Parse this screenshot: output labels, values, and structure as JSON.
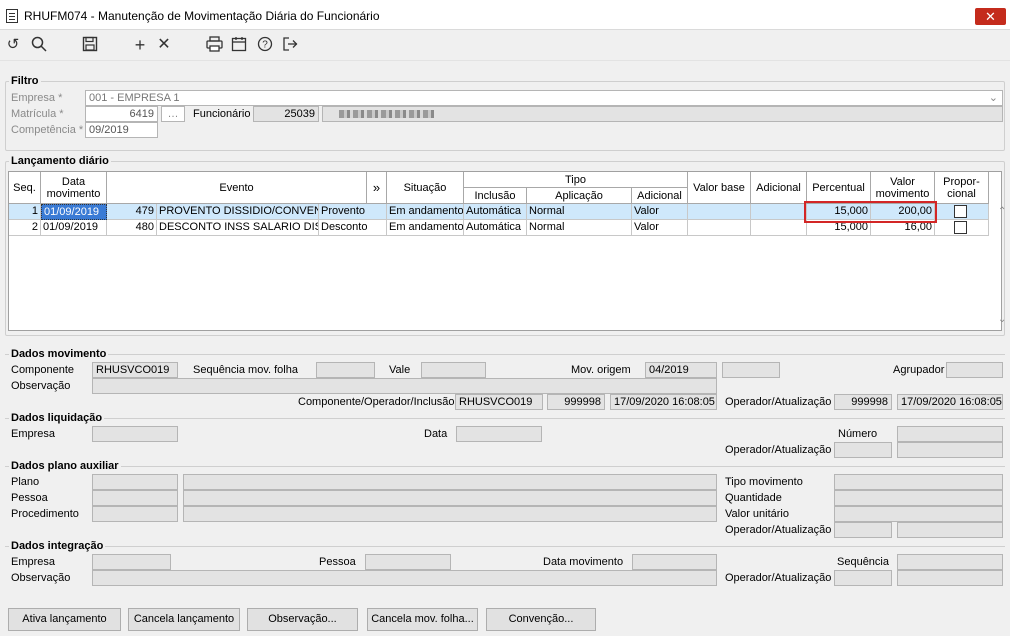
{
  "window": {
    "title": "RHUFM074 - Manutenção de Movimentação Diária do Funcionário",
    "close_label": "✕"
  },
  "toolbar": {
    "icons": [
      "undo-icon",
      "search-icon",
      "save-icon",
      "add-icon",
      "cancel-icon",
      "print-icon",
      "calendar-icon",
      "help-icon",
      "exit-icon"
    ]
  },
  "filtro": {
    "legend": "Filtro",
    "empresa_label": "Empresa *",
    "empresa_value": "001 - EMPRESA 1",
    "matricula_label": "Matrícula *",
    "matricula_value": "6419",
    "funcionario_label": "Funcionário",
    "funcionario_value": "25039",
    "competencia_label": "Competência *",
    "competencia_value": "09/2019"
  },
  "lancamento": {
    "legend": "Lançamento diário",
    "headers": {
      "seq": "Seq.",
      "data": "Data movimento",
      "evento": "Evento",
      "more": "»",
      "situacao": "Situação",
      "tipo": "Tipo",
      "inclusao": "Inclusão",
      "aplicacao": "Aplicação",
      "adicional": "Adicional",
      "valor_base": "Valor base",
      "adicional2": "Adicional",
      "percentual": "Percentual",
      "valor_movimento": "Valor movimento",
      "proporcional": "Propor-cional"
    },
    "rows": [
      {
        "seq": "1",
        "data": "01/09/2019",
        "codigo": "479",
        "evento": "PROVENTO DISSIDIO/CONVENCÃ",
        "tipo_evento": "Provento",
        "situacao": "Em andamento",
        "inclusao": "Automática",
        "aplicacao": "Normal",
        "adicional": "Valor",
        "valor_base": "",
        "adicional2": "",
        "percentual": "15,000",
        "valor_movimento": "200,00"
      },
      {
        "seq": "2",
        "data": "01/09/2019",
        "codigo": "480",
        "evento": "DESCONTO INSS SALARIO DISS",
        "tipo_evento": "Desconto",
        "situacao": "Em andamento",
        "inclusao": "Automática",
        "aplicacao": "Normal",
        "adicional": "Valor",
        "valor_base": "",
        "adicional2": "",
        "percentual": "15,000",
        "valor_movimento": "16,00"
      }
    ]
  },
  "movimento": {
    "legend": "Dados movimento",
    "componente_label": "Componente",
    "componente_value": "RHUSVCO019",
    "sequencia_label": "Sequência mov. folha",
    "vale_label": "Vale",
    "mov_origem_label": "Mov. origem",
    "mov_origem_value": "04/2019",
    "agrupador_label": "Agrupador",
    "observacao_label": "Observação",
    "comp_op_label": "Componente/Operador/Inclusão",
    "comp_value": "RHUSVCO019",
    "op_value": "999998",
    "inclusao_value": "17/09/2020 16:08:05",
    "op_atual_label": "Operador/Atualização",
    "op_atual_value": "999998",
    "atual_value": "17/09/2020 16:08:05"
  },
  "liquidacao": {
    "legend": "Dados liquidação",
    "empresa_label": "Empresa",
    "data_label": "Data",
    "numero_label": "Número",
    "op_atual_label": "Operador/Atualização"
  },
  "plano": {
    "legend": "Dados plano auxiliar",
    "plano_label": "Plano",
    "pessoa_label": "Pessoa",
    "procedimento_label": "Procedimento",
    "tipo_mov_label": "Tipo movimento",
    "quantidade_label": "Quantidade",
    "valor_unit_label": "Valor unitário",
    "op_atual_label": "Operador/Atualização"
  },
  "integracao": {
    "legend": "Dados integração",
    "empresa_label": "Empresa",
    "pessoa_label": "Pessoa",
    "data_mov_label": "Data movimento",
    "sequencia_label": "Sequência",
    "observacao_label": "Observação",
    "op_atual_label": "Operador/Atualização"
  },
  "buttons": {
    "ativa": "Ativa lançamento",
    "cancela": "Cancela lançamento",
    "observacao": "Observação...",
    "cancela_mov": "Cancela mov. folha...",
    "convencao": "Convenção..."
  }
}
